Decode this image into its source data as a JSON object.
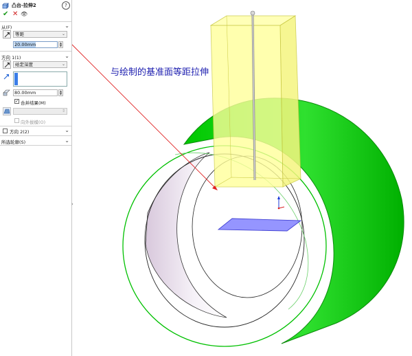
{
  "header": {
    "title": "凸台-拉伸2",
    "help": "?"
  },
  "actions": {
    "ok": "✔",
    "cancel": "✕",
    "preview": "👁"
  },
  "from": {
    "section_label": "从(F)",
    "type_value": "等距",
    "offset_value": "20.00mm"
  },
  "direction1": {
    "section_label": "方向 1(1)",
    "end_condition": "给定深度",
    "depth_value": "80.00mm",
    "merge_label": "合并结果(M)",
    "merge_checked": "✓",
    "draft_outward_label": "向外拔模(O)"
  },
  "direction2": {
    "section_label": "方向 2(2)"
  },
  "selected_contours": {
    "section_label": "所选轮廓(S)"
  },
  "viewport": {
    "annotation": "与绘制的基准面等距拉伸"
  },
  "colors": {
    "accent_blue": "#3a7ee8",
    "solid_green": "#00d400",
    "preview_yellow": "#ffff9a",
    "annotation_blue": "#1f20b0",
    "leader_red": "#e02020"
  }
}
